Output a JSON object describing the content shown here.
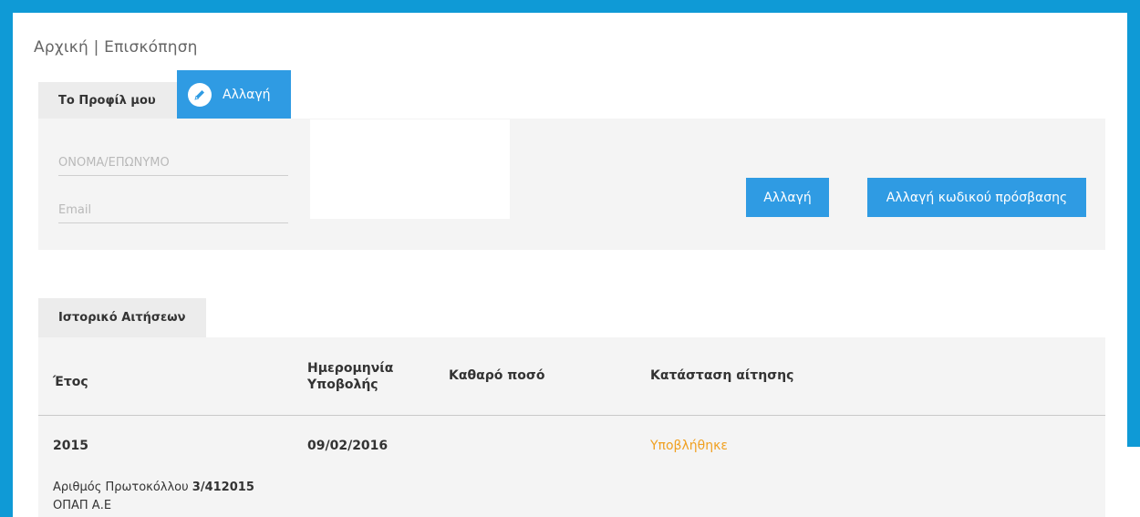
{
  "breadcrumb": {
    "home": "Αρχική",
    "separator": "|",
    "current": "Επισκόπηση"
  },
  "profile": {
    "tab_label": "Το Προφίλ μου",
    "edit_tab_label": "Αλλαγή",
    "name_placeholder": "ΟΝΟΜΑ/ΕΠΩΝΥΜΟ",
    "email_placeholder": "Email",
    "change_button": "Αλλαγή",
    "change_password_button": "Αλλαγή κωδικού πρόσβασης"
  },
  "history": {
    "tab_label": "Ιστορικό Αιτήσεων",
    "columns": {
      "year": "Έτος",
      "date": "Ημερομηνία Υποβολής",
      "amount": "Καθαρό ποσό",
      "status": "Κατάσταση αίτησης"
    },
    "rows": [
      {
        "year": "2015",
        "date": "09/02/2016",
        "amount": "",
        "status": "Υποβλήθηκε",
        "protocol_label": "Αριθμός Πρωτοκόλλου",
        "protocol_number": "3/412015",
        "company": "ΟΠΑΠ Α.Ε"
      }
    ]
  },
  "colors": {
    "frame": "#0f9ad6",
    "primary_button": "#2f9be3",
    "status_submitted": "#f0a020"
  },
  "icons": {
    "edit": "pencil-icon"
  }
}
